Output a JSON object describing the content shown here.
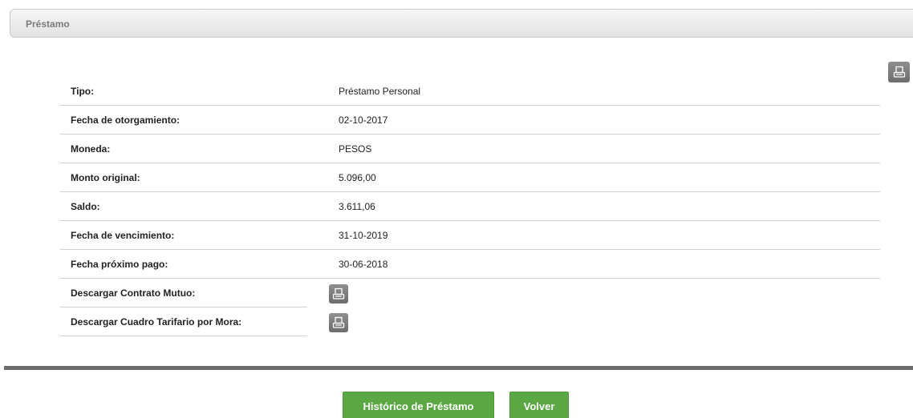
{
  "panel": {
    "title": "Préstamo"
  },
  "details": {
    "rows": [
      {
        "label": "Tipo:",
        "value": "Préstamo Personal"
      },
      {
        "label": "Fecha de otorgamiento:",
        "value": "02-10-2017"
      },
      {
        "label": "Moneda:",
        "value": "PESOS"
      },
      {
        "label": "Monto original:",
        "value": "5.096,00"
      },
      {
        "label": "Saldo:",
        "value": "3.611,06"
      },
      {
        "label": "Fecha de vencimiento:",
        "value": "31-10-2019"
      },
      {
        "label": "Fecha próximo pago:",
        "value": "30-06-2018"
      }
    ],
    "downloads": [
      {
        "label": "Descargar Contrato Mutuo:",
        "icon": "printer-icon"
      },
      {
        "label": "Descargar Cuadro Tarifario por Mora:",
        "icon": "printer-icon"
      }
    ]
  },
  "print_button": {
    "icon": "printer-icon"
  },
  "actions": {
    "historico_label": "Histórico de Préstamo",
    "volver_label": "Volver"
  },
  "colors": {
    "button_green": "#5aa743",
    "icon_gray": "#7d7d7d",
    "divider": "#6d6d6d"
  }
}
